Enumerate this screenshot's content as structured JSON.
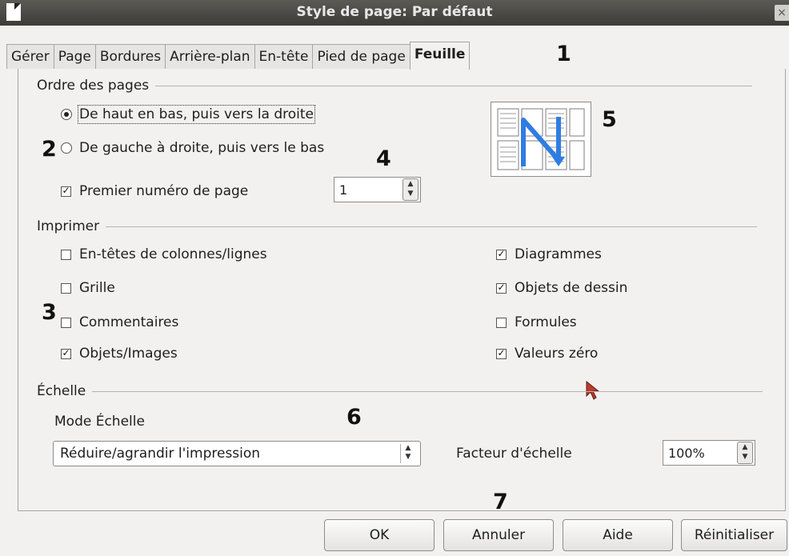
{
  "window": {
    "title": "Style de page: Par défaut",
    "close_glyph": "×"
  },
  "tabs": [
    "Gérer",
    "Page",
    "Bordures",
    "Arrière-plan",
    "En-tête",
    "Pied de page",
    "Feuille"
  ],
  "active_tab": "Feuille",
  "page_order": {
    "heading": "Ordre des pages",
    "option_top_down": "De haut en bas, puis vers la droite",
    "option_left_right": "De gauche à droite, puis vers le bas",
    "selected": "top_down",
    "first_page_label": "Premier numéro de page",
    "first_page_checked": true,
    "first_page_value": "1"
  },
  "print": {
    "heading": "Imprimer",
    "left": [
      {
        "label": "En-têtes de colonnes/lignes",
        "checked": false
      },
      {
        "label": "Grille",
        "checked": false
      },
      {
        "label": "Commentaires",
        "checked": false
      },
      {
        "label": "Objets/Images",
        "checked": true
      }
    ],
    "right": [
      {
        "label": "Diagrammes",
        "checked": true
      },
      {
        "label": "Objets de dessin",
        "checked": true
      },
      {
        "label": "Formules",
        "checked": false
      },
      {
        "label": "Valeurs zéro",
        "checked": true
      }
    ]
  },
  "scale": {
    "heading": "Échelle",
    "mode_label": "Mode Échelle",
    "mode_value": "Réduire/agrandir l'impression",
    "factor_label": "Facteur d'échelle",
    "factor_value": "100%"
  },
  "buttons": {
    "ok": "OK",
    "cancel": "Annuler",
    "help": "Aide",
    "reset": "Réinitialiser"
  },
  "annotations": [
    "1",
    "2",
    "3",
    "4",
    "5",
    "6",
    "7"
  ],
  "colors": {
    "title_bar": "#3c3b37",
    "preview_arrow": "#2f7de1"
  }
}
